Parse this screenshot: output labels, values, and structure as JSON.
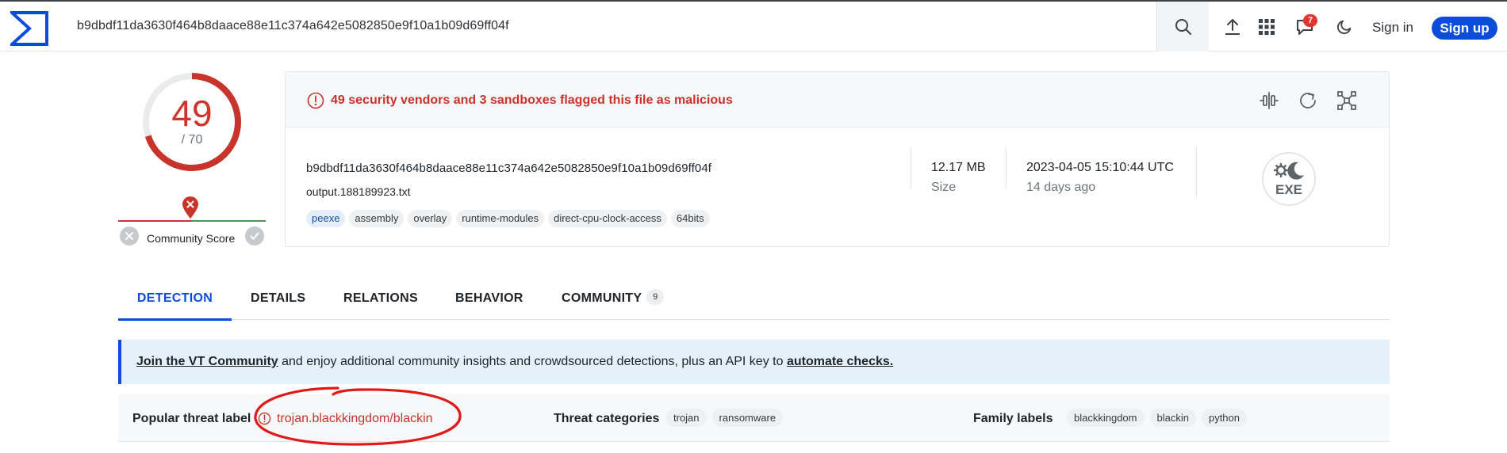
{
  "header": {
    "search_value": "b9dbdf11da3630f464b8daace88e11c374a642e5082850e9f10a1b09d69ff04f",
    "notification_count": "7",
    "signin_label": "Sign in",
    "signup_label": "Sign up",
    "icons": [
      "logo-icon",
      "search-icon",
      "upload-icon",
      "apps-grid-icon",
      "notifications-icon",
      "dark-mode-icon"
    ],
    "accent_color": "#0b4dda"
  },
  "score": {
    "detections": "49",
    "total": "/ 70",
    "detection_fraction": 0.7,
    "community_label": "Community Score"
  },
  "summary": {
    "alert_text": "49 security vendors and 3 sandboxes flagged this file as malicious",
    "hash": "b9dbdf11da3630f464b8daace88e11c374a642e5082850e9f10a1b09d69ff04f",
    "filename": "output.188189923.txt",
    "tags": [
      "peexe",
      "assembly",
      "overlay",
      "runtime-modules",
      "direct-cpu-clock-access",
      "64bits"
    ],
    "size_value": "12.17 MB",
    "size_label": "Size",
    "date_value": "2023-04-05 15:10:44 UTC",
    "date_relative": "14 days ago",
    "filetype_badge": "EXE",
    "alert_color": "#c8332b"
  },
  "tabs": {
    "items": [
      {
        "label": "DETECTION",
        "active": true
      },
      {
        "label": "DETAILS"
      },
      {
        "label": "RELATIONS"
      },
      {
        "label": "BEHAVIOR"
      },
      {
        "label": "COMMUNITY",
        "count": "9"
      }
    ]
  },
  "banner": {
    "link1": "Join the VT Community",
    "middle": " and enjoy additional community insights and crowdsourced detections, plus an API key to ",
    "link2": "automate checks."
  },
  "threat": {
    "popular_label": "Popular threat label",
    "popular_value": "trojan.blackkingdom/blackin",
    "categories_label": "Threat categories",
    "categories": [
      "trojan",
      "ransomware"
    ],
    "family_label": "Family labels",
    "families": [
      "blackkingdom",
      "blackin",
      "python"
    ]
  }
}
